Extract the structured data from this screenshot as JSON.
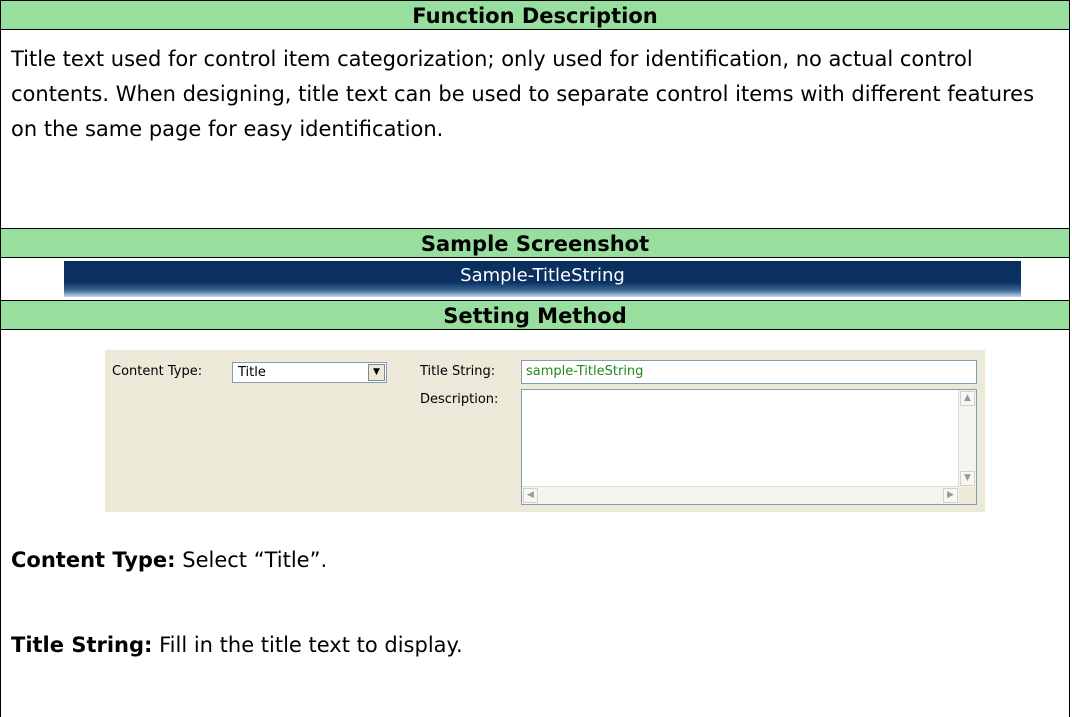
{
  "sections": {
    "function_header": "Function Description",
    "screenshot_header": "Sample Screenshot",
    "setting_header": "Setting Method"
  },
  "description_text": "Title text used for control item categorization; only used for identification, no actual control contents. When designing, title text can be used to separate control items with different features on the same page for easy identification.",
  "sample_banner": {
    "text": "Sample-TitleString"
  },
  "settings_panel": {
    "content_type_label": "Content Type:",
    "content_type_value": "Title",
    "title_string_label": "Title String:",
    "title_string_value": "sample-TitleString",
    "description_label": "Description:"
  },
  "notes": {
    "content_type_bold": "Content Type:",
    "content_type_text": " Select “Title”.",
    "title_string_bold": "Title String:",
    "title_string_text": " Fill in the title text to display."
  },
  "colors": {
    "header_bg": "#98de9e",
    "banner_bg": "#0b3162",
    "panel_bg": "#ece9d8",
    "input_text": "#1f8a1f"
  }
}
